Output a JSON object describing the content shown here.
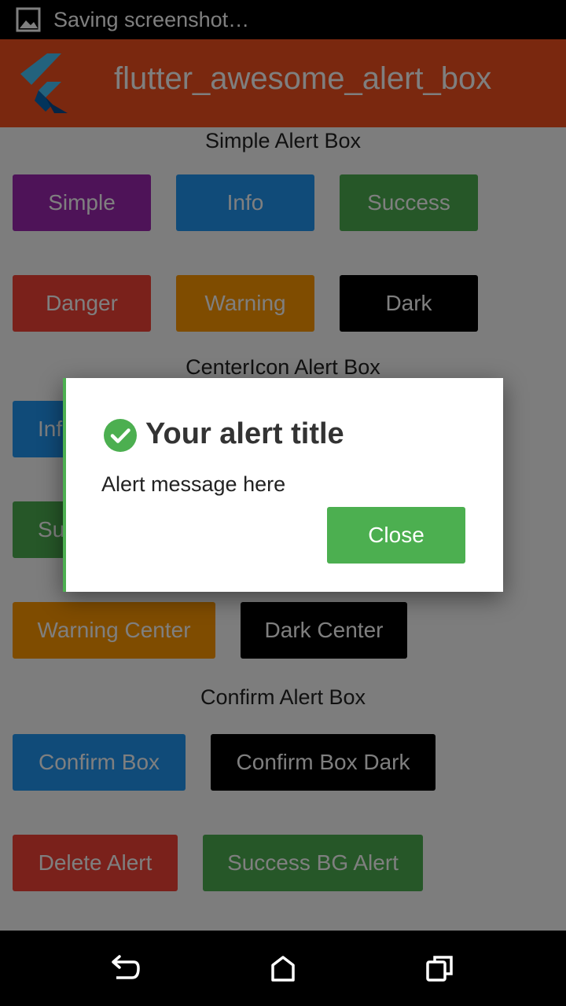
{
  "status_bar": {
    "text": "Saving screenshot…",
    "icon": "image-icon"
  },
  "app_bar": {
    "title": "flutter_awesome_alert_box",
    "logo": "flutter-logo-icon"
  },
  "sections": {
    "simple": {
      "title": "Simple Alert Box",
      "buttons": [
        "Simple",
        "Info",
        "Success",
        "Danger",
        "Warning",
        "Dark"
      ]
    },
    "center_icon": {
      "title": "CenterIcon Alert Box",
      "buttons": [
        "Info Center",
        "Success Center",
        "Warning Center",
        "Dark Center"
      ]
    },
    "confirm": {
      "title": "Confirm Alert Box",
      "buttons": [
        "Confirm Box",
        "Confirm Box Dark",
        "Delete Alert",
        "Success BG Alert"
      ]
    }
  },
  "dialog": {
    "icon": "check-circle-icon",
    "title": "Your alert title",
    "message": "Alert message here",
    "close_label": "Close",
    "accent": "#4caf50"
  },
  "nav_bar": {
    "icons": [
      "back-icon",
      "home-icon",
      "recents-icon"
    ]
  },
  "colors": {
    "app_bar": "#f4511e",
    "purple": "#9c27b0",
    "blue": "#2196f3",
    "green": "#4caf50",
    "red": "#f44336",
    "orange": "#ff9800",
    "black": "#000000"
  }
}
